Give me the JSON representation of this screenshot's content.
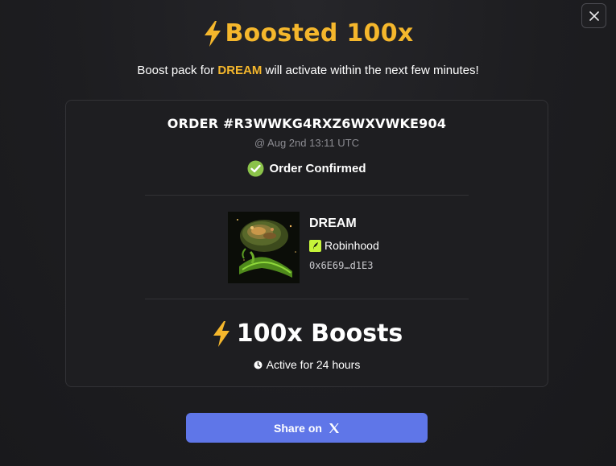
{
  "modal": {
    "title": "Boosted 100x",
    "subtitle_prefix": "Boost pack for ",
    "subtitle_token": "DREAM",
    "subtitle_suffix": " will activate within the next few minutes!",
    "accent_color": "#f5b72c"
  },
  "order": {
    "id": "ORDER #R3WWKG4RXZ6WXVWKE904",
    "date": "@ Aug 2nd 13:11 UTC",
    "status": "Order Confirmed",
    "status_color": "#8bc34a"
  },
  "token": {
    "symbol": "DREAM",
    "chain": "Robinhood",
    "chain_color": "#c6f43a",
    "address": "0x6E69…d1E3",
    "icon": "token-avatar-image"
  },
  "boost": {
    "amount_label": "100x Boosts",
    "duration_label": "Active for 24 hours",
    "icon": "lightning-bolt-icon"
  },
  "share": {
    "label": "Share on",
    "icon": "x-logo-icon",
    "color": "#5f76e8"
  },
  "close": {
    "icon": "close-icon"
  }
}
